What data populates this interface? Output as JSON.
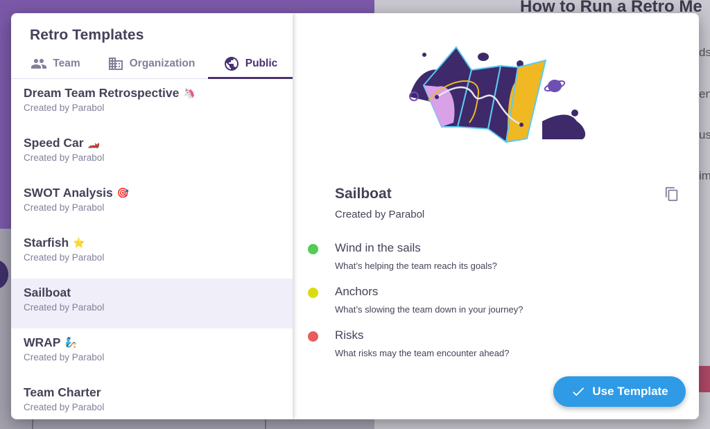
{
  "background": {
    "heading": "How to Run a Retro Me",
    "fragments": [
      "ds",
      "en",
      "uss",
      "im"
    ]
  },
  "modal": {
    "title": "Retro Templates",
    "tabs": [
      {
        "label": "Team",
        "icon": "people-icon",
        "active": false
      },
      {
        "label": "Organization",
        "icon": "building-icon",
        "active": false
      },
      {
        "label": "Public",
        "icon": "globe-icon",
        "active": true
      }
    ],
    "templates": [
      {
        "name": "Dream Team Retrospective",
        "emoji": "🦄",
        "creator": "Created by Parabol",
        "selected": false
      },
      {
        "name": "Speed Car",
        "emoji": "🏎️",
        "creator": "Created by Parabol",
        "selected": false
      },
      {
        "name": "SWOT Analysis",
        "emoji": "🎯",
        "creator": "Created by Parabol",
        "selected": false
      },
      {
        "name": "Starfish",
        "emoji": "⭐",
        "creator": "Created by Parabol",
        "selected": false
      },
      {
        "name": "Sailboat",
        "emoji": "",
        "creator": "Created by Parabol",
        "selected": true
      },
      {
        "name": "WRAP",
        "emoji": "🧞",
        "creator": "Created by Parabol",
        "selected": false
      },
      {
        "name": "Team Charter",
        "emoji": "",
        "creator": "Created by Parabol",
        "selected": false
      }
    ],
    "detail": {
      "title": "Sailboat",
      "creator": "Created by Parabol",
      "copy_icon": "copy-icon",
      "prompts": [
        {
          "title": "Wind in the sails",
          "description": "What’s helping the team reach its goals?",
          "color": "#52cc52"
        },
        {
          "title": "Anchors",
          "description": "What’s slowing the team down in your journey?",
          "color": "#dbdb12"
        },
        {
          "title": "Risks",
          "description": "What risks may the team encounter ahead?",
          "color": "#e85d5d"
        }
      ],
      "use_button": "Use Template"
    }
  },
  "colors": {
    "accent_purple": "#493272",
    "button_blue": "#2f9ae5",
    "selected_row": "#f0eff9",
    "text_dark": "#444258",
    "text_muted": "#82809a"
  }
}
